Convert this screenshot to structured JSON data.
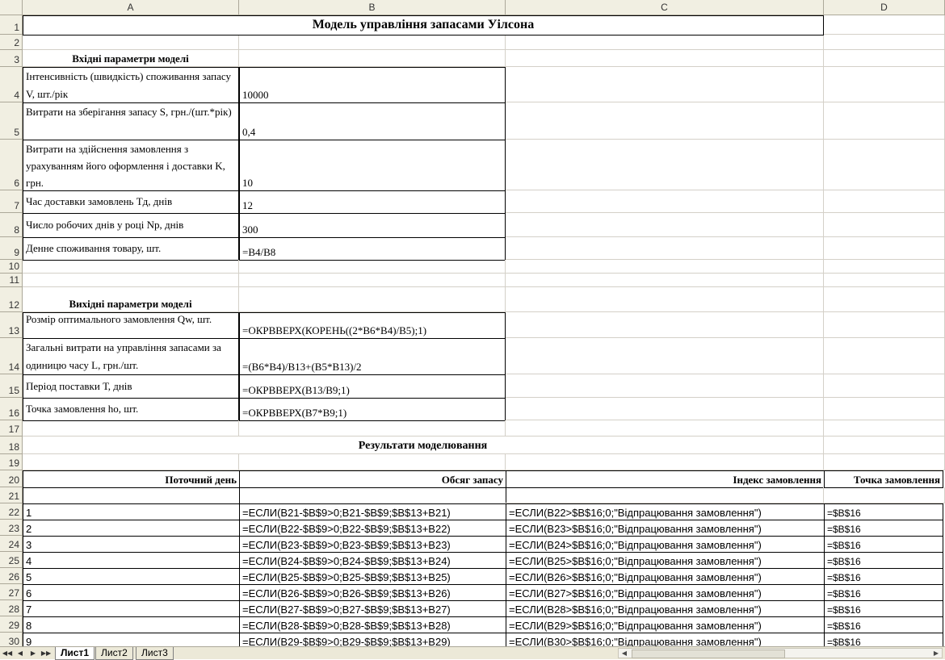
{
  "columns": [
    "A",
    "B",
    "C",
    "D"
  ],
  "rows": [
    "1",
    "2",
    "3",
    "4",
    "5",
    "6",
    "7",
    "8",
    "9",
    "10",
    "11",
    "12",
    "13",
    "14",
    "15",
    "16",
    "17",
    "18",
    "19",
    "20",
    "21",
    "22",
    "23",
    "24",
    "25",
    "26",
    "27",
    "28",
    "29",
    "30"
  ],
  "title": "Модель управління запасами Уілсона",
  "inputs_header": "Вхідні параметри моделі",
  "inputs": [
    {
      "label": "Інтенсивність (швидкість) споживання запасу V, шт./рік",
      "value": "10000"
    },
    {
      "label": "Витрати на зберігання запасу S, грн./(шт.*рік)",
      "value": "0,4"
    },
    {
      "label": "Витрати на здійснення замовлення з урахуванням його оформлення і доставки K, грн.",
      "value": "10"
    },
    {
      "label": "Час доставки замовлень Тд, днів",
      "value": "12"
    },
    {
      "label": "Число робочих днів у році Np, днів",
      "value": "300"
    },
    {
      "label": "Денне споживання товару, шт.",
      "value": "=B4/B8"
    }
  ],
  "outputs_header": "Вихідні параметри моделі",
  "outputs": [
    {
      "label": "Розмір оптимального замовлення Qw, шт.",
      "value": "=ОКРВВЕРХ(КОРЕНЬ((2*B6*B4)/B5);1)"
    },
    {
      "label": "Загальні витрати на управління запасами за одиницю часу L, грн./шт.",
      "value": "=(B6*B4)/B13+(B5*B13)/2"
    },
    {
      "label": "Період поставки Т, днів",
      "value": "=ОКРВВЕРХ(B13/B9;1)"
    },
    {
      "label": "Точка замовлення ho, шт.",
      "value": "=ОКРВВЕРХ(B7*B9;1)"
    }
  ],
  "results_header": "Результати моделювання",
  "table_headers": [
    "Поточний день",
    "Обсяг запасу",
    "Індекс замовлення",
    "Точка замовлення"
  ],
  "table_rows": [
    [
      "1",
      "=ЕСЛИ(B21-$B$9>0;B21-$B$9;$B$13+B21)",
      "=ЕСЛИ(B22>$B$16;0;\"Відпрацювання замовлення\")",
      "=$B$16"
    ],
    [
      "2",
      "=ЕСЛИ(B22-$B$9>0;B22-$B$9;$B$13+B22)",
      "=ЕСЛИ(B23>$B$16;0;\"Відпрацювання замовлення\")",
      "=$B$16"
    ],
    [
      "3",
      "=ЕСЛИ(B23-$B$9>0;B23-$B$9;$B$13+B23)",
      "=ЕСЛИ(B24>$B$16;0;\"Відпрацювання замовлення\")",
      "=$B$16"
    ],
    [
      "4",
      "=ЕСЛИ(B24-$B$9>0;B24-$B$9;$B$13+B24)",
      "=ЕСЛИ(B25>$B$16;0;\"Відпрацювання замовлення\")",
      "=$B$16"
    ],
    [
      "5",
      "=ЕСЛИ(B25-$B$9>0;B25-$B$9;$B$13+B25)",
      "=ЕСЛИ(B26>$B$16;0;\"Відпрацювання замовлення\")",
      "=$B$16"
    ],
    [
      "6",
      "=ЕСЛИ(B26-$B$9>0;B26-$B$9;$B$13+B26)",
      "=ЕСЛИ(B27>$B$16;0;\"Відпрацювання замовлення\")",
      "=$B$16"
    ],
    [
      "7",
      "=ЕСЛИ(B27-$B$9>0;B27-$B$9;$B$13+B27)",
      "=ЕСЛИ(B28>$B$16;0;\"Відпрацювання замовлення\")",
      "=$B$16"
    ],
    [
      "8",
      "=ЕСЛИ(B28-$B$9>0;B28-$B$9;$B$13+B28)",
      "=ЕСЛИ(B29>$B$16;0;\"Відпрацювання замовлення\")",
      "=$B$16"
    ],
    [
      "9",
      "=ЕСЛИ(B29-$B$9>0;B29-$B$9;$B$13+B29)",
      "=ЕСЛИ(B30>$B$16;0;\"Відпрацювання замовлення\")",
      "=$B$16"
    ]
  ],
  "sheet_tabs": [
    "Лист1",
    "Лист2",
    "Лист3"
  ],
  "active_tab": "Лист1"
}
